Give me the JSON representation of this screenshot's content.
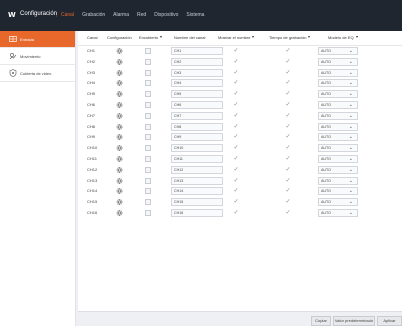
{
  "app": {
    "logo": "W",
    "title": "Configuración",
    "separator": "|"
  },
  "topnav": [
    "Canal",
    "Grabación",
    "Alarma",
    "Red",
    "Dispositivo",
    "Sistema"
  ],
  "sidebar": [
    {
      "label": "Entrada",
      "icon": "camera-input-icon"
    },
    {
      "label": "Movimiento",
      "icon": "motion-icon"
    },
    {
      "label": "Cubierta de video",
      "icon": "video-cover-icon"
    }
  ],
  "table": {
    "headers": [
      "Canal",
      "Configuración",
      "Encubierto",
      "Nombre del canal",
      "Mostrar el nombre",
      "Tiempo de grabación",
      "Modelo de EQ"
    ],
    "rows": [
      {
        "channel": "CH1",
        "name": "CH1",
        "eq": "AUTO"
      },
      {
        "channel": "CH2",
        "name": "CH2",
        "eq": "AUTO"
      },
      {
        "channel": "CH3",
        "name": "CH3",
        "eq": "AUTO"
      },
      {
        "channel": "CH4",
        "name": "CH4",
        "eq": "AUTO"
      },
      {
        "channel": "CH5",
        "name": "CH5",
        "eq": "AUTO"
      },
      {
        "channel": "CH6",
        "name": "CH6",
        "eq": "AUTO"
      },
      {
        "channel": "CH7",
        "name": "CH7",
        "eq": "AUTO"
      },
      {
        "channel": "CH8",
        "name": "CH8",
        "eq": "AUTO"
      },
      {
        "channel": "CH9",
        "name": "CH9",
        "eq": "AUTO"
      },
      {
        "channel": "CH10",
        "name": "CH10",
        "eq": "AUTO"
      },
      {
        "channel": "CH11",
        "name": "CH11",
        "eq": "AUTO"
      },
      {
        "channel": "CH12",
        "name": "CH12",
        "eq": "AUTO"
      },
      {
        "channel": "CH13",
        "name": "CH13",
        "eq": "AUTO"
      },
      {
        "channel": "CH14",
        "name": "CH14",
        "eq": "AUTO"
      },
      {
        "channel": "CH15",
        "name": "CH15",
        "eq": "AUTO"
      },
      {
        "channel": "CH16",
        "name": "CH16",
        "eq": "AUTO"
      }
    ]
  },
  "footer": {
    "copy": "Copiar",
    "defaults": "Valor predeterminado",
    "apply": "Aplicar"
  },
  "colors": {
    "accent": "#e8682c",
    "topbar": "#1f2630"
  }
}
